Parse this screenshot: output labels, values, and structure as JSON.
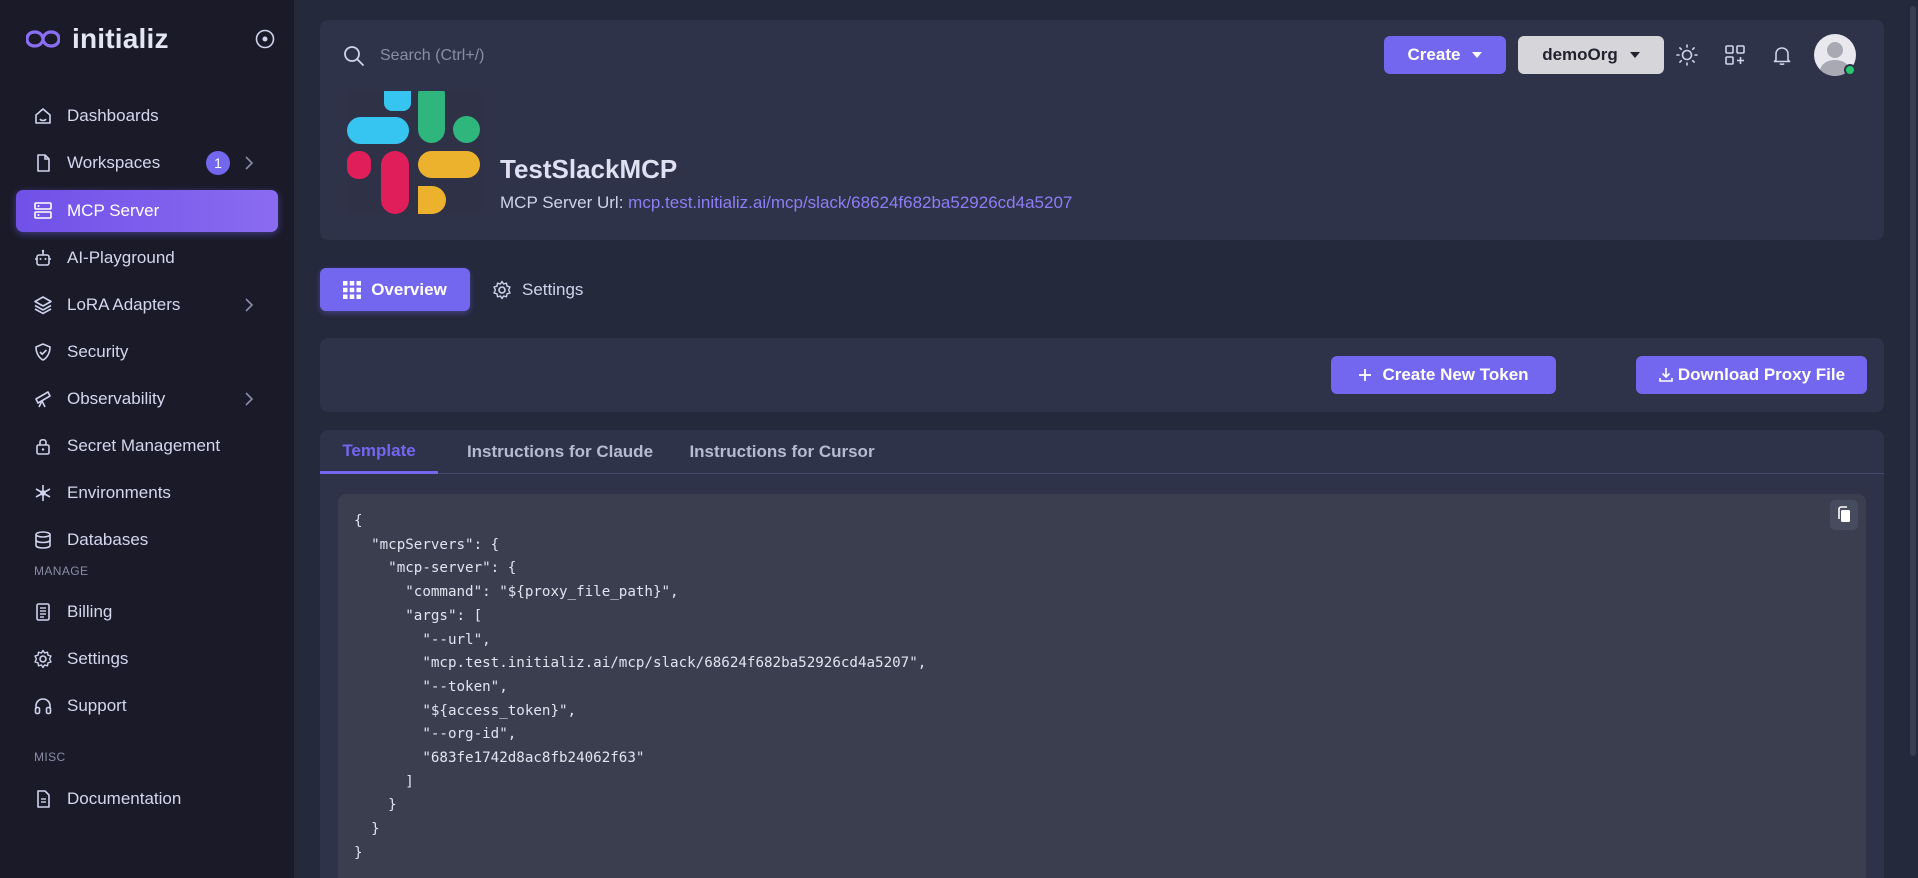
{
  "brand": {
    "name": "initializ"
  },
  "sidebar": {
    "items": [
      {
        "label": "Dashboards",
        "icon": "home-icon"
      },
      {
        "label": "Workspaces",
        "icon": "file-icon",
        "badge": "1",
        "has_children": true
      },
      {
        "label": "MCP Server",
        "icon": "server-icon",
        "active": true
      },
      {
        "label": "AI-Playground",
        "icon": "robot-icon"
      },
      {
        "label": "LoRA Adapters",
        "icon": "layers-icon",
        "has_children": true
      },
      {
        "label": "Security",
        "icon": "shield-check-icon"
      },
      {
        "label": "Observability",
        "icon": "telescope-icon",
        "has_children": true
      },
      {
        "label": "Secret Management",
        "icon": "lock-icon"
      },
      {
        "label": "Environments",
        "icon": "snowflake-icon"
      },
      {
        "label": "Databases",
        "icon": "database-icon"
      }
    ],
    "sections": {
      "manage": "MANAGE",
      "misc": "MISC"
    },
    "manage_items": [
      {
        "label": "Billing",
        "icon": "receipt-icon"
      },
      {
        "label": "Settings",
        "icon": "gear-icon"
      },
      {
        "label": "Support",
        "icon": "headphones-icon"
      }
    ],
    "misc_items": [
      {
        "label": "Documentation",
        "icon": "document-icon"
      }
    ]
  },
  "topbar": {
    "search_placeholder": "Search (Ctrl+/)",
    "create_label": "Create",
    "org_label": "demoOrg"
  },
  "server": {
    "title": "TestSlackMCP",
    "url_label": "MCP Server Url:",
    "url": "mcp.test.initializ.ai/mcp/slack/68624f682ba52926cd4a5207"
  },
  "tabs": {
    "overview": "Overview",
    "settings": "Settings"
  },
  "actions": {
    "create_token": "Create New Token",
    "download_proxy": "Download Proxy File"
  },
  "subtabs": [
    "Template",
    "Instructions for Claude",
    "Instructions for Cursor"
  ],
  "code": "{\n  \"mcpServers\": {\n    \"mcp-server\": {\n      \"command\": \"${proxy_file_path}\",\n      \"args\": [\n        \"--url\",\n        \"mcp.test.initializ.ai/mcp/slack/68624f682ba52926cd4a5207\",\n        \"--token\",\n        \"${access_token}\",\n        \"--org-id\",\n        \"683fe1742d8ac8fb24062f63\"\n      ]\n    }\n  }\n}",
  "colors": {
    "primary": "#7367f0",
    "background": "#25293c",
    "sidebar": "#1a1a28",
    "card": "#2f3349",
    "code_bg": "#3a3e4f",
    "status_online": "#28c76f"
  }
}
